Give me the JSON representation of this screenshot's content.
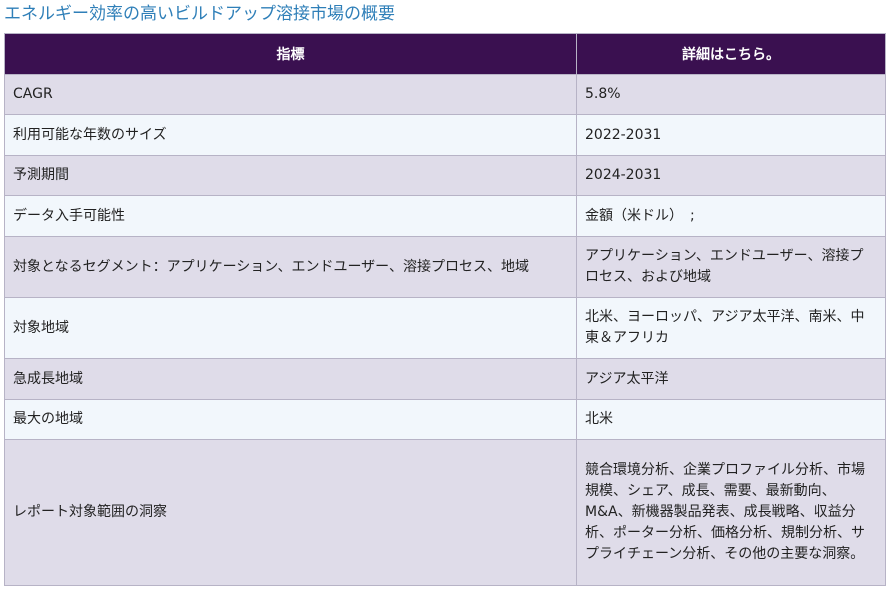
{
  "page": {
    "title": "エネルギー効率の高いビルドアップ溶接市場の概要"
  },
  "table": {
    "headers": [
      "指標",
      "詳細はこちら。"
    ],
    "rows": [
      {
        "metric": "CAGR",
        "detail": "5.8%"
      },
      {
        "metric": "利用可能な年数のサイズ",
        "detail": "2022-2031"
      },
      {
        "metric": "予測期間",
        "detail": "2024-2031"
      },
      {
        "metric": "データ入手可能性",
        "detail": "金額（米ドル）　;"
      },
      {
        "metric": "対象となるセグメント：アプリケーション、エンドユーザー、溶接プロセス、地域",
        "detail": "アプリケーション、エンドユーザー、溶接プロセス、および地域"
      },
      {
        "metric": "対象地域",
        "detail": "北米、ヨーロッパ、アジア太平洋、南米、中東＆アフリカ"
      },
      {
        "metric": "急成長地域",
        "detail": "アジア太平洋"
      },
      {
        "metric": "最大の地域",
        "detail": "北米"
      },
      {
        "metric": "レポート対象範囲の洞察",
        "detail": "競合環境分析、企業プロファイル分析、市場規模、シェア、成長、需要、最新動向、M&A、新機器製品発表、成長戦略、収益分析、ポーター分析、価格分析、規制分析、サプライチェーン分析、その他の主要な洞察。"
      }
    ]
  }
}
